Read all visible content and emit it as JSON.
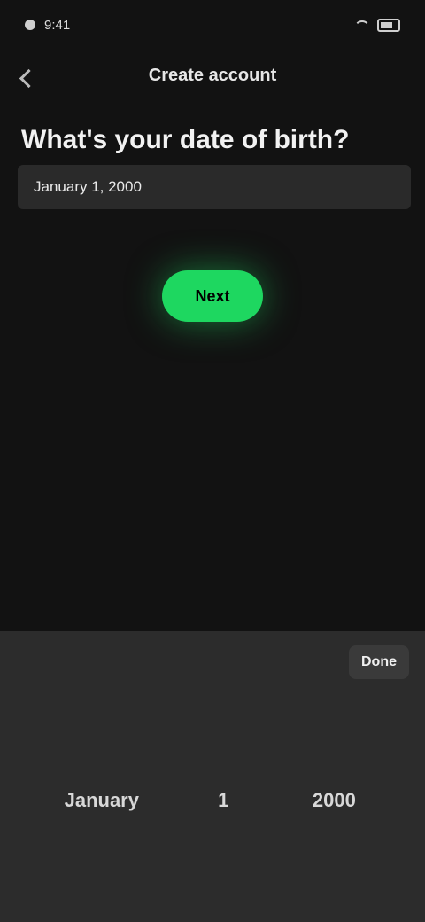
{
  "status": {
    "time": "9:41",
    "battery": "100%"
  },
  "nav": {
    "title": "Create account"
  },
  "form": {
    "heading": "What's your date of birth?",
    "date_value": "January 1, 2000",
    "next_label": "Next"
  },
  "keyboard": {
    "done_label": "Done",
    "row1": [
      "",
      "",
      ""
    ],
    "row2": [
      "January",
      "1",
      "2000"
    ],
    "row3": [
      "",
      "",
      ""
    ]
  },
  "colors": {
    "accent": "#1ed760",
    "background": "#121212",
    "keyboard_bg": "#2c2c2c"
  }
}
